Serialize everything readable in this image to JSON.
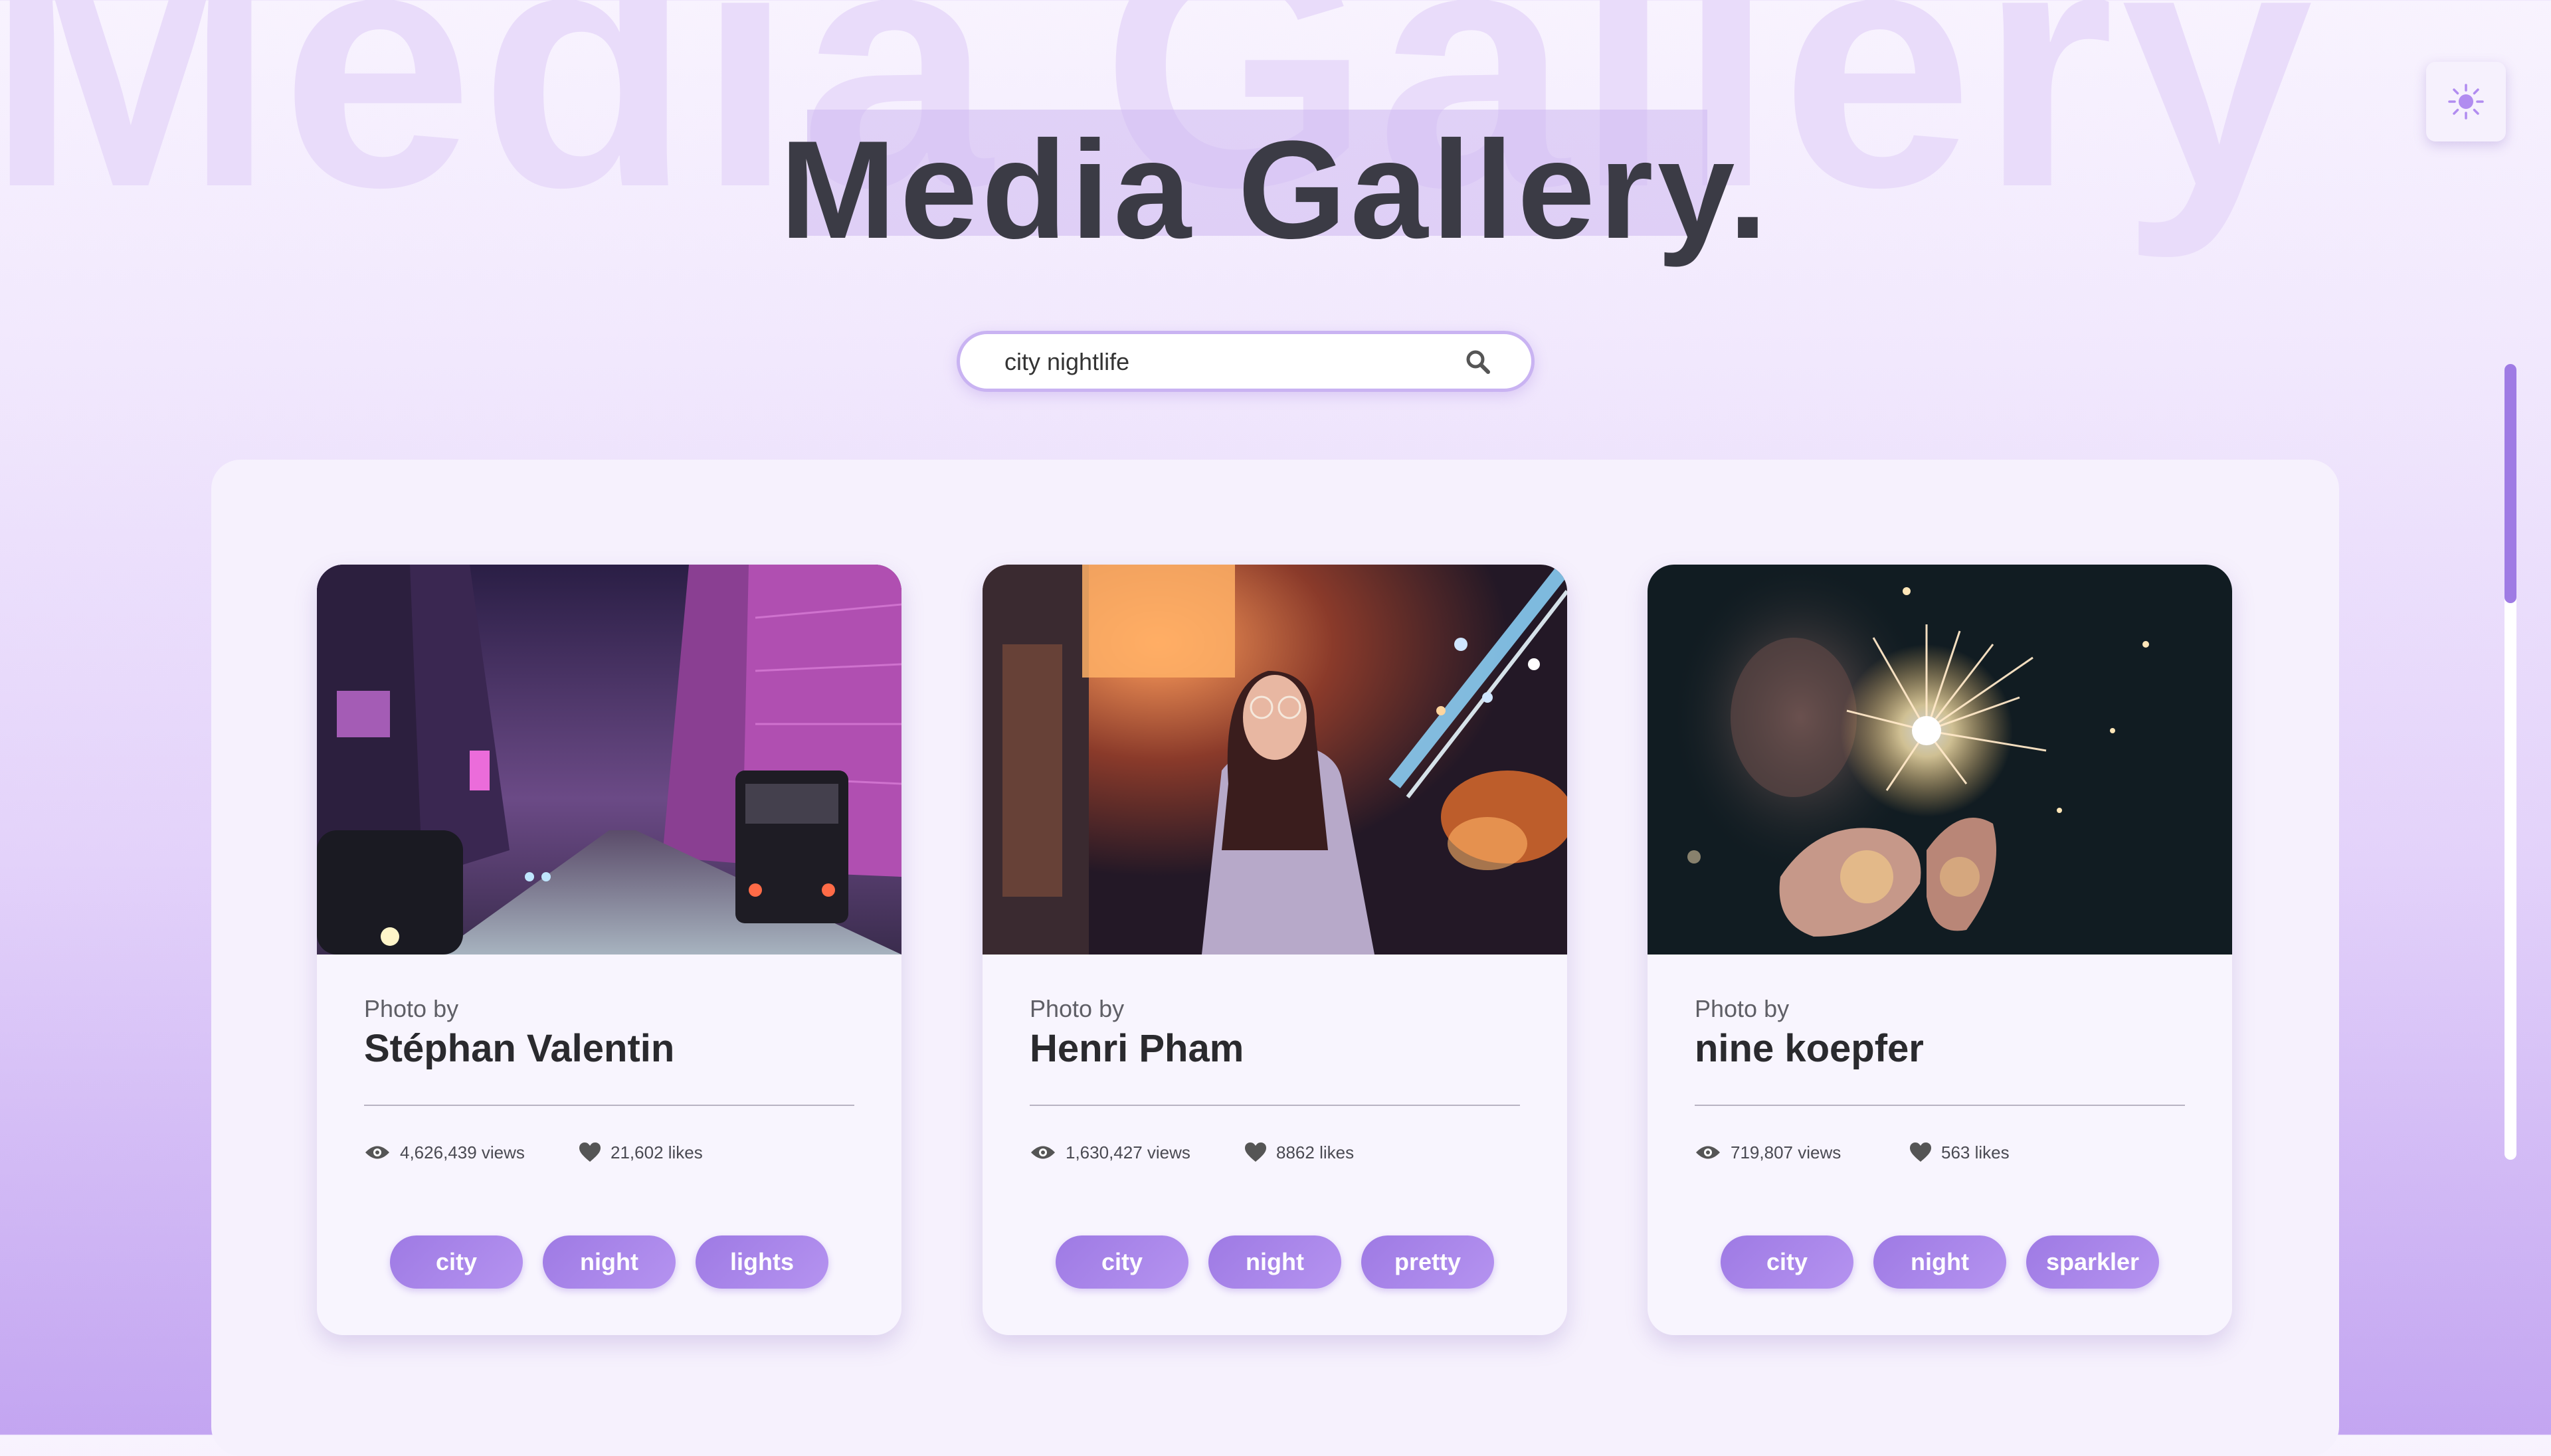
{
  "page": {
    "title": "Media Gallery.",
    "background_title": "Media Gallery"
  },
  "search": {
    "value": "city nightlife",
    "placeholder": "Search images..."
  },
  "theme_toggle": {
    "icon": "sun-icon"
  },
  "cards": [
    {
      "photo_by": "Photo by",
      "photographer": "Stéphan Valentin",
      "views": "4,626,439 views",
      "likes": "21,602 likes",
      "tags": [
        "city",
        "night",
        "lights"
      ]
    },
    {
      "photo_by": "Photo by",
      "photographer": "Henri Pham",
      "views": "1,630,427 views",
      "likes": "8862 likes",
      "tags": [
        "city",
        "night",
        "pretty"
      ]
    },
    {
      "photo_by": "Photo by",
      "photographer": "nine koepfer",
      "views": "719,807 views",
      "likes": "563 likes",
      "tags": [
        "city",
        "night",
        "sparkler"
      ]
    }
  ],
  "colors": {
    "accent": "#9e7ae4",
    "title": "#3b3b45",
    "panel": "#f6f1fd"
  }
}
